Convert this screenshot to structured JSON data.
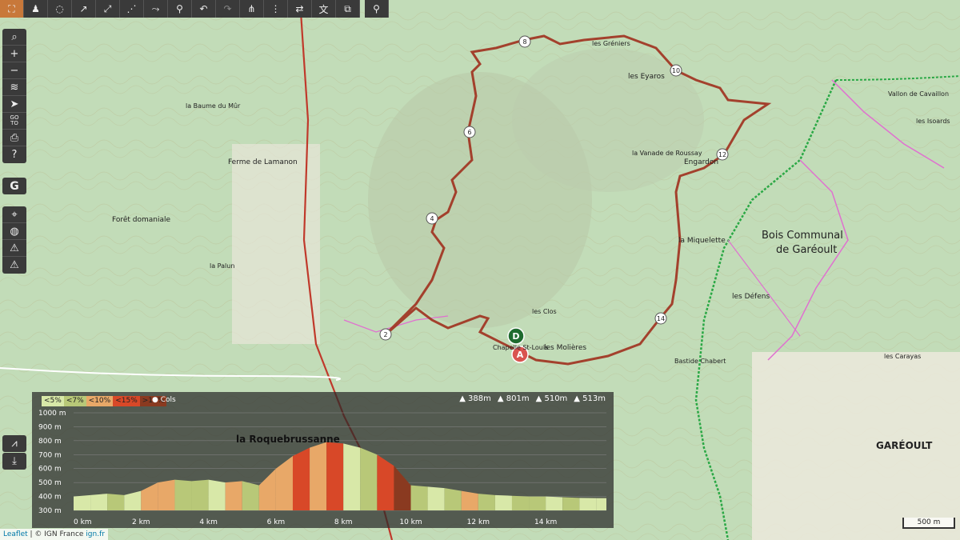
{
  "toolbar": {
    "items": [
      {
        "name": "fullscreen-icon",
        "glyph": "⛶"
      },
      {
        "name": "hiker-icon",
        "glyph": "♟"
      },
      {
        "name": "hide-icon",
        "glyph": "◌"
      },
      {
        "name": "draw-line-icon",
        "glyph": "↗"
      },
      {
        "name": "draw-segment-icon",
        "glyph": "⤢"
      },
      {
        "name": "node-icon",
        "glyph": "⋰"
      },
      {
        "name": "route-icon",
        "glyph": "⤳"
      },
      {
        "name": "bike-icon",
        "glyph": "⚲"
      },
      {
        "name": "undo-icon",
        "glyph": "↶"
      },
      {
        "name": "redo-icon",
        "glyph": "↷"
      },
      {
        "name": "split-icon",
        "glyph": "⋔"
      },
      {
        "name": "join-icon",
        "glyph": "⋮"
      },
      {
        "name": "reverse-icon",
        "glyph": "⇄"
      },
      {
        "name": "translate-icon",
        "glyph": "文"
      },
      {
        "name": "copy-icon",
        "glyph": "⧉"
      },
      {
        "name": "marker-icon",
        "glyph": "⚲"
      }
    ]
  },
  "leftbar": {
    "group1": [
      {
        "name": "search-icon",
        "glyph": "⌕"
      },
      {
        "name": "zoom-in-icon",
        "glyph": "+"
      },
      {
        "name": "zoom-out-icon",
        "glyph": "−"
      },
      {
        "name": "layers-icon",
        "glyph": "≋"
      },
      {
        "name": "locate-icon",
        "glyph": "➤"
      },
      {
        "name": "go-to-icon",
        "glyph": "GO\nTO"
      },
      {
        "name": "print-icon",
        "glyph": "⎙"
      },
      {
        "name": "help-icon",
        "glyph": "?"
      }
    ],
    "google": {
      "glyph": "G"
    },
    "group2": [
      {
        "name": "crosshair-icon",
        "glyph": "⌖"
      },
      {
        "name": "globe-icon",
        "glyph": "◍"
      },
      {
        "name": "warning-icon",
        "glyph": "⚠"
      },
      {
        "name": "warning2-icon",
        "glyph": "⚠"
      }
    ],
    "profile_toggle": "⩘",
    "download": "⤓"
  },
  "map_labels": [
    {
      "text": "la Roquebrussanne",
      "x": 0,
      "y": 0
    },
    {
      "text": "Bois Communal",
      "x": 0,
      "y": 0
    },
    {
      "text": "de Garéoult",
      "x": 0,
      "y": 0
    },
    {
      "text": "GARÉOULT",
      "x": 0,
      "y": 0
    },
    {
      "text": "Forêt domaniale",
      "x": 0,
      "y": 0
    },
    {
      "text": "les Eyaros",
      "x": 0,
      "y": 0
    },
    {
      "text": "Engardon",
      "x": 0,
      "y": 0
    },
    {
      "text": "la Miquelette",
      "x": 0,
      "y": 0
    },
    {
      "text": "les Défens",
      "x": 0,
      "y": 0
    },
    {
      "text": "Chapelle St-Louis",
      "x": 0,
      "y": 0
    },
    {
      "text": "les Molières",
      "x": 0,
      "y": 0
    },
    {
      "text": "Bastide Chabert",
      "x": 0,
      "y": 0
    },
    {
      "text": "la Vanade de Roussay",
      "x": 0,
      "y": 0
    },
    {
      "text": "les Gréniers",
      "x": 0,
      "y": 0
    },
    {
      "text": "Ferme de Lamanon",
      "x": 0,
      "y": 0
    },
    {
      "text": "la Palun",
      "x": 0,
      "y": 0
    },
    {
      "text": "la Baume du Mûr",
      "x": 0,
      "y": 0
    },
    {
      "text": "Vallon de Cavaillon",
      "x": 0,
      "y": 0
    },
    {
      "text": "les Isoards",
      "x": 0,
      "y": 0
    },
    {
      "text": "les Clos",
      "x": 0,
      "y": 0
    },
    {
      "text": "les Carayas",
      "x": 0,
      "y": 0
    }
  ],
  "route": {
    "color": "#a0301e",
    "waypoints": [
      {
        "label": "2"
      },
      {
        "label": "4"
      },
      {
        "label": "6"
      },
      {
        "label": "8"
      },
      {
        "label": "10"
      },
      {
        "label": "12"
      },
      {
        "label": "14"
      }
    ],
    "start_label": "D",
    "end_label": "A"
  },
  "profile": {
    "legend": [
      {
        "label": "<5%",
        "color": "#d8e8a8"
      },
      {
        "label": "<7%",
        "color": "#b8c878"
      },
      {
        "label": "<10%",
        "color": "#e8a868"
      },
      {
        "label": "<15%",
        "color": "#d84828"
      },
      {
        "label": ">15%",
        "color": "#8a3a20"
      }
    ],
    "cols_label": "Cols",
    "stats": [
      "388m",
      "801m",
      "510m",
      "513m"
    ],
    "town_label": "la Roquebrussanne"
  },
  "chart_data": {
    "type": "area",
    "xlabel": "",
    "ylabel": "",
    "x_ticks": [
      "0 km",
      "2 km",
      "4 km",
      "6 km",
      "8 km",
      "10 km",
      "12 km",
      "14 km"
    ],
    "y_ticks": [
      "1000 m",
      "900 m",
      "800 m",
      "700 m",
      "600 m",
      "500 m",
      "400 m",
      "300 m"
    ],
    "xlim": [
      0,
      15.8
    ],
    "ylim": [
      300,
      1000
    ],
    "x": [
      0,
      0.5,
      1,
      1.5,
      2,
      2.5,
      3,
      3.5,
      4,
      4.5,
      5,
      5.5,
      6,
      6.5,
      7,
      7.5,
      8,
      8.5,
      9,
      9.5,
      10,
      10.5,
      11,
      11.5,
      12,
      12.5,
      13,
      13.5,
      14,
      14.5,
      15,
      15.5,
      15.8
    ],
    "elevation": [
      400,
      410,
      420,
      410,
      440,
      500,
      520,
      510,
      520,
      500,
      510,
      480,
      600,
      690,
      750,
      790,
      780,
      750,
      700,
      620,
      480,
      470,
      460,
      440,
      420,
      410,
      405,
      400,
      400,
      395,
      390,
      388,
      388
    ],
    "slope_class": [
      1,
      1,
      2,
      1,
      3,
      3,
      2,
      2,
      1,
      3,
      2,
      3,
      3,
      4,
      3,
      4,
      1,
      2,
      4,
      5,
      2,
      1,
      2,
      3,
      2,
      1,
      2,
      2,
      1,
      2,
      1,
      1,
      1
    ]
  },
  "footer": {
    "leaflet": "Leaflet",
    "sep": " | © ",
    "ign": "IGN France",
    "url": " ign.fr"
  },
  "scale": "500 m"
}
